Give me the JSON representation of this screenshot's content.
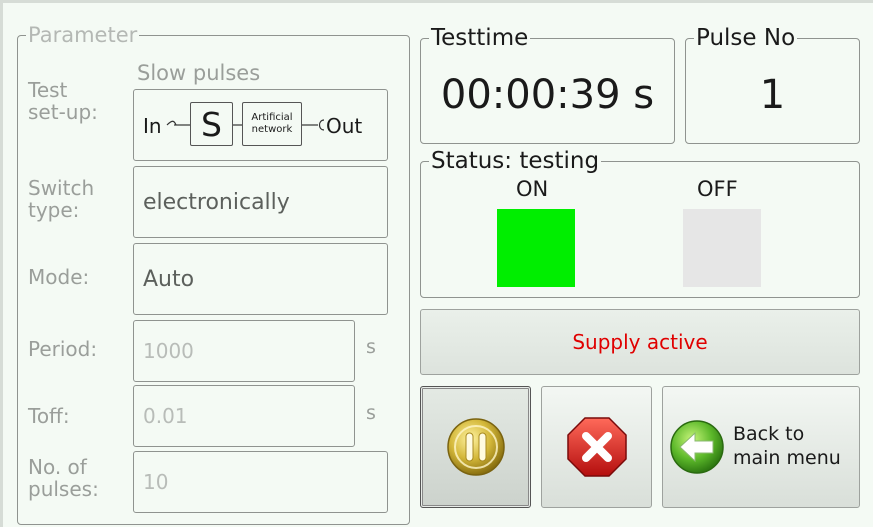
{
  "parameter": {
    "title": "Parameter",
    "test_setup_label": "Test\nset-up:",
    "setup_name": "Slow pulses",
    "diagram": {
      "in": "In",
      "switch": "S",
      "network": "Artificial\nnetwork",
      "out": "Out"
    },
    "switch_type_label": "Switch\ntype:",
    "switch_type_value": "electronically",
    "mode_label": "Mode:",
    "mode_value": "Auto",
    "period_label": "Period:",
    "period_value": "1000",
    "period_unit": "s",
    "toff_label": "Toff:",
    "toff_value": "0.01",
    "toff_unit": "s",
    "pulses_label": "No. of\npulses:",
    "pulses_value": "10"
  },
  "testtime": {
    "title": "Testtime",
    "value": "00:00:39 s"
  },
  "pulse_no": {
    "title": "Pulse No",
    "value": "1"
  },
  "status": {
    "title": "Status: testing",
    "on_label": "ON",
    "off_label": "OFF",
    "on_color": "#00ee00",
    "off_color": "#e6e6e6"
  },
  "supply": {
    "text": "Supply active",
    "color": "#e00000"
  },
  "buttons": {
    "pause_icon": "pause-icon",
    "stop_icon": "stop-icon",
    "back_icon": "back-arrow-icon",
    "back_label": "Back to\nmain menu"
  }
}
